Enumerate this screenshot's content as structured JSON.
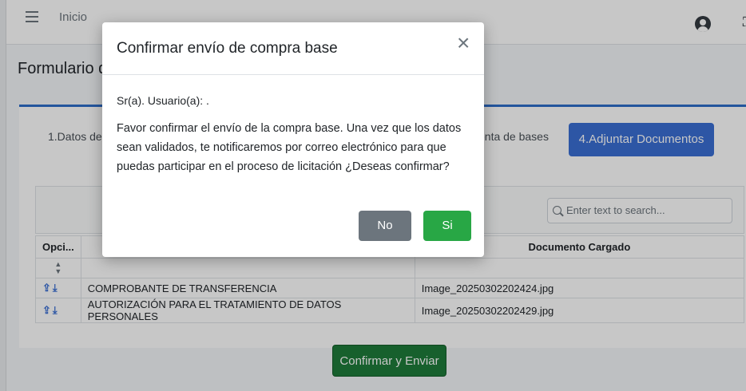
{
  "topbar": {
    "title": "Inicio",
    "user_icon": "user-circle-icon",
    "menu_icon": "hamburger-icon"
  },
  "page": {
    "title": "Formulario d"
  },
  "steps": {
    "step1": "1.Datos de",
    "step3": "enta de bases",
    "step4": "4.Adjuntar Documentos"
  },
  "table": {
    "search_placeholder": "Enter text to search...",
    "headers": {
      "opciones": "Opci...",
      "cargado": "Documento Cargado"
    },
    "rows": [
      {
        "document": "COMPROBANTE DE TRANSFERENCIA",
        "file": "Image_20250302202424.jpg"
      },
      {
        "document": "AUTORIZACIÓN PARA EL TRATAMIENTO DE DATOS PERSONALES",
        "file": "Image_20250302202429.jpg"
      }
    ]
  },
  "actions": {
    "confirm_send": "Confirmar y Enviar"
  },
  "modal": {
    "title": "Confirmar envío de compra base",
    "close": "×",
    "greeting": "Sr(a). Usuario(a): .",
    "body": "Favor confirmar el envío de la compra base. Una vez que los datos sean validados, te notificaremos por correo electrónico para que puedas participar en el proceso de licitación ¿Deseas confirmar?",
    "no_label": "No",
    "si_label": "Si"
  },
  "colors": {
    "primary": "#3a6fd4",
    "success": "#28a745",
    "secondary": "#6c757d",
    "confirm": "#1e7b3a"
  }
}
